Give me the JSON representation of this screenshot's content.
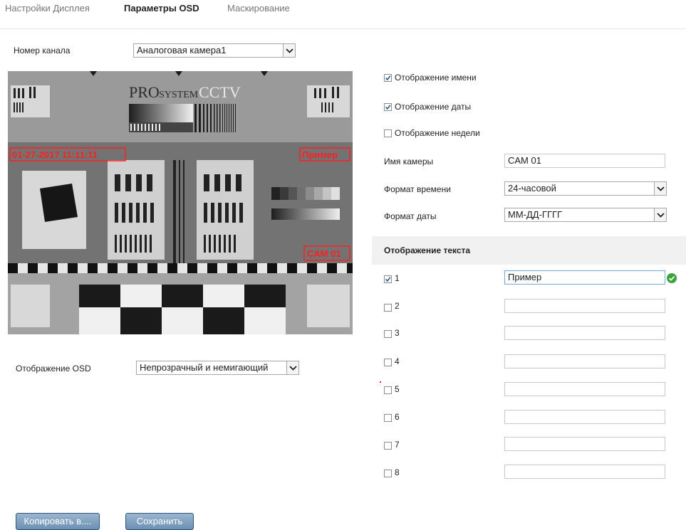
{
  "tabs": [
    "Настройки Дисплея",
    "Параметры OSD",
    "Маскирование"
  ],
  "channel": {
    "label": "Номер канала",
    "value": "Аналоговая камера1"
  },
  "preview": {
    "logo_pro": "PRO",
    "logo_system": "SYSTEM",
    "logo_cctv": "CCTV",
    "osd_datetime": "01-27-2017 11:11:11",
    "osd_sample": "Пример",
    "osd_camera": "CAM 01"
  },
  "osd_display": {
    "label": "Отображение OSD",
    "value": "Непрозрачный и немигающий"
  },
  "options": {
    "show_name": {
      "label": "Отображение имени",
      "checked": true
    },
    "show_date": {
      "label": "Отображение даты",
      "checked": true
    },
    "show_week": {
      "label": "Отображение недели",
      "checked": false
    }
  },
  "camera_name": {
    "label": "Имя камеры",
    "value": "CAM 01"
  },
  "time_format": {
    "label": "Формат времени",
    "value": "24-часовой"
  },
  "date_format": {
    "label": "Формат даты",
    "value": "ММ-ДД-ГГГГ"
  },
  "text_section": {
    "title": "Отображение текста"
  },
  "text_rows": [
    {
      "num": "1",
      "checked": true,
      "value": "Пример"
    },
    {
      "num": "2",
      "checked": false,
      "value": ""
    },
    {
      "num": "3",
      "checked": false,
      "value": ""
    },
    {
      "num": "4",
      "checked": false,
      "value": ""
    },
    {
      "num": "5",
      "checked": false,
      "value": ""
    },
    {
      "num": "6",
      "checked": false,
      "value": ""
    },
    {
      "num": "7",
      "checked": false,
      "value": ""
    },
    {
      "num": "8",
      "checked": false,
      "value": ""
    }
  ],
  "buttons": {
    "copy": "Копировать в....",
    "save": "Сохранить"
  },
  "colors": {
    "accent": "#6d90b3",
    "osd_red": "#ff2020",
    "valid_green": "#3aa33a"
  }
}
